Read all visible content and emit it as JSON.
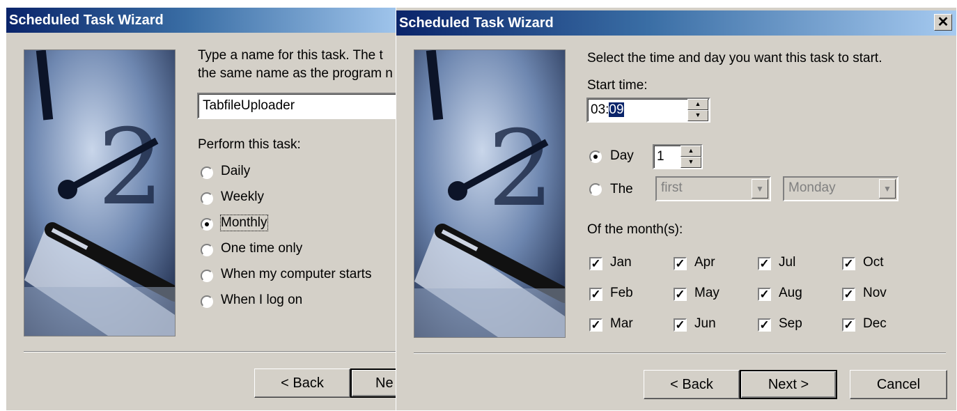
{
  "left": {
    "title": "Scheduled Task Wizard",
    "prompt_line1": "Type a name for this task.  The t",
    "prompt_line2": "the same name as the program n",
    "task_name": "TabfileUploader",
    "perform_label": "Perform this task:",
    "options": [
      {
        "label": "Daily",
        "selected": false
      },
      {
        "label": "Weekly",
        "selected": false
      },
      {
        "label": "Monthly",
        "selected": true
      },
      {
        "label": "One time only",
        "selected": false
      },
      {
        "label": "When my computer starts",
        "selected": false
      },
      {
        "label": "When I log on",
        "selected": false
      }
    ],
    "back_label": "< Back",
    "next_label_partial": "Ne"
  },
  "right": {
    "title": "Scheduled Task Wizard",
    "close_glyph": "✕",
    "instruction": "Select the time and day you want this task to start.",
    "start_time_label": "Start time:",
    "start_time_hours": "03:",
    "start_time_minutes": "09",
    "day_label": "Day",
    "day_value": "1",
    "the_label": "The",
    "week_select": "first",
    "weekday_select": "Monday",
    "day_selected": true,
    "months_label": "Of the month(s):",
    "months": [
      {
        "label": "Jan",
        "checked": true
      },
      {
        "label": "Feb",
        "checked": true
      },
      {
        "label": "Mar",
        "checked": true
      },
      {
        "label": "Apr",
        "checked": true
      },
      {
        "label": "May",
        "checked": true
      },
      {
        "label": "Jun",
        "checked": true
      },
      {
        "label": "Jul",
        "checked": true
      },
      {
        "label": "Aug",
        "checked": true
      },
      {
        "label": "Sep",
        "checked": true
      },
      {
        "label": "Oct",
        "checked": true
      },
      {
        "label": "Nov",
        "checked": true
      },
      {
        "label": "Dec",
        "checked": true
      }
    ],
    "back_label": "< Back",
    "next_label": "Next >",
    "cancel_label": "Cancel"
  },
  "icons": {
    "check_glyph": "✓",
    "spin_up": "▲",
    "spin_down": "▼",
    "combo_arrow": "▼"
  }
}
